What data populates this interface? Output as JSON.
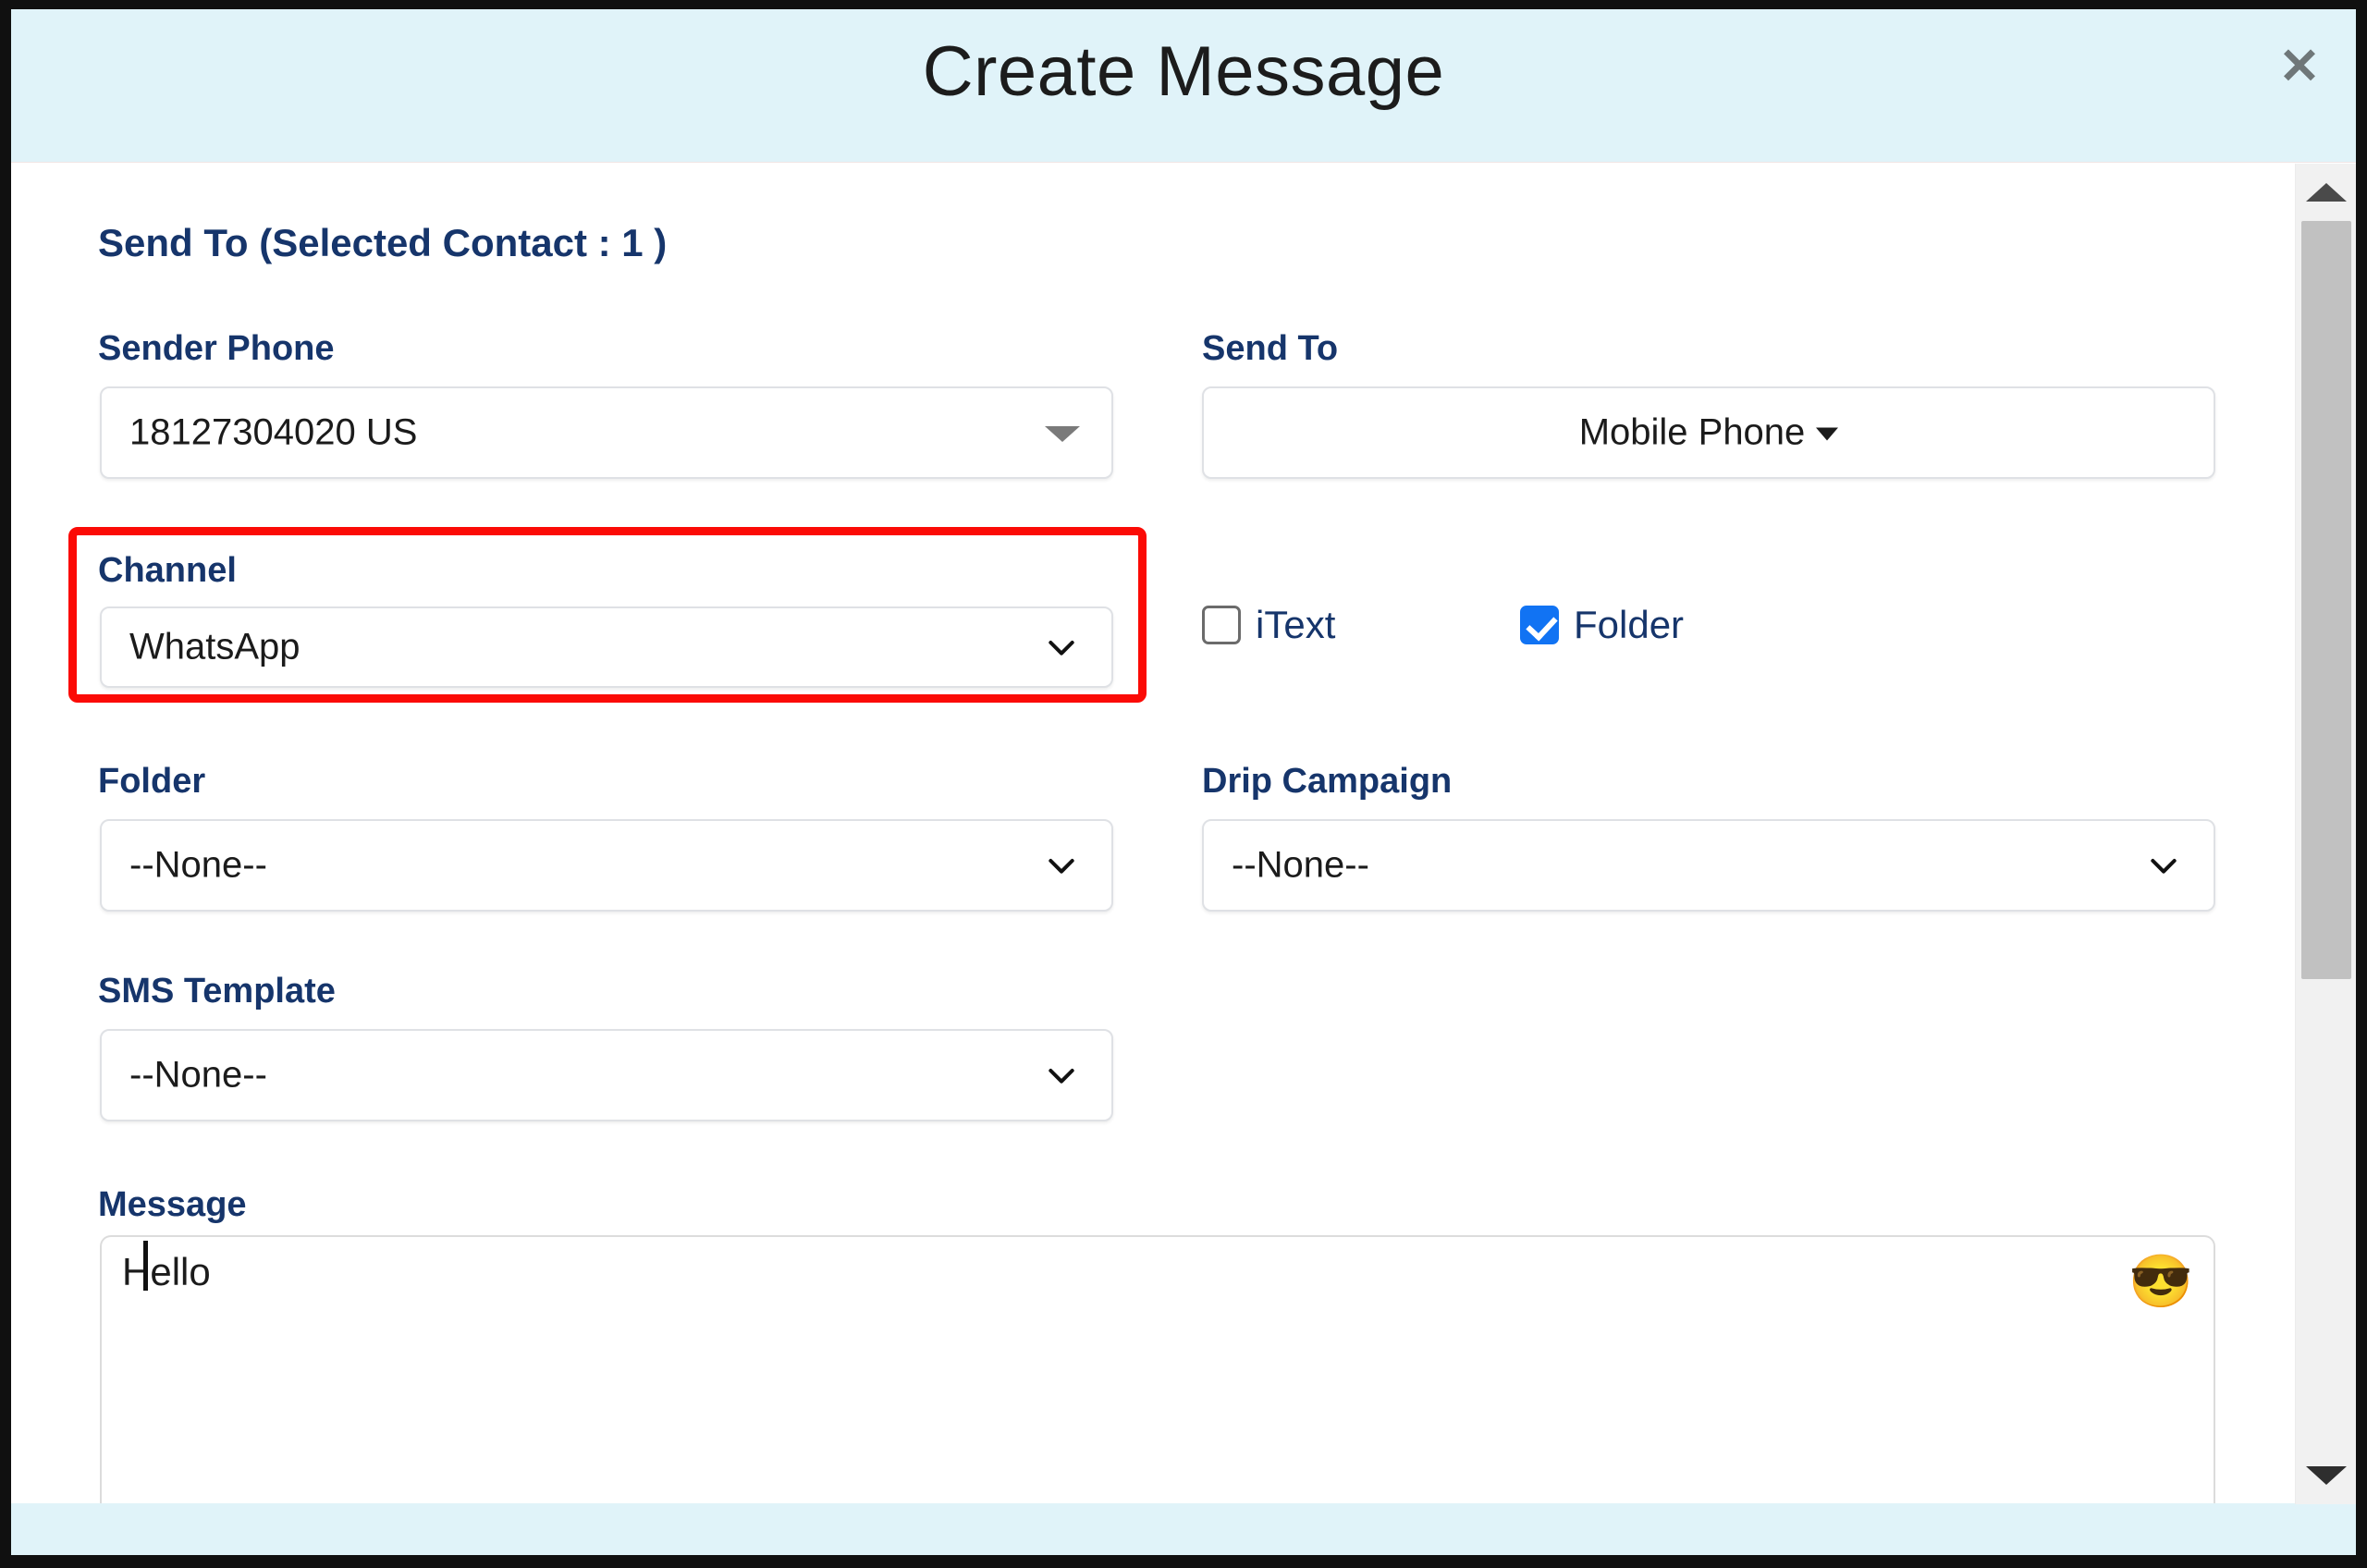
{
  "modal": {
    "title": "Create Message",
    "close_icon": "close-icon",
    "close_label": "✕",
    "header_bg": "#e0f3f9",
    "accent_highlight": "#fb0b06",
    "label_color": "#16356b",
    "checkbox_checked_color": "#1173f3"
  },
  "send_to_summary": "Send To (Selected Contact : 1 )",
  "fields": {
    "sender_phone": {
      "label": "Sender Phone",
      "value": "18127304020 US",
      "icon": "triangle-down-icon"
    },
    "send_to": {
      "label": "Send To",
      "value": "Mobile Phone",
      "icon": "caret-down-icon"
    },
    "channel": {
      "label": "Channel",
      "value": "WhatsApp",
      "icon": "chevron-down-icon",
      "highlighted": "true"
    },
    "folder": {
      "label": "Folder",
      "value": "--None--",
      "icon": "chevron-down-icon"
    },
    "drip_campaign": {
      "label": "Drip Campaign",
      "value": "--None--",
      "icon": "chevron-down-icon"
    },
    "sms_template": {
      "label": "SMS Template",
      "value": "--None--",
      "icon": "chevron-down-icon"
    },
    "message": {
      "label": "Message",
      "value": "Hello ",
      "placeholder": "",
      "emoji_icon": "sunglasses-smiley-icon",
      "emoji_glyph": "😎"
    }
  },
  "checkboxes": [
    {
      "label": "iText",
      "checked": false
    },
    {
      "label": "Folder",
      "checked": true
    }
  ],
  "scrollbar": {
    "up_icon": "scroll-up-arrow-icon",
    "down_icon": "scroll-down-arrow-icon",
    "thumb_name": "scrollbar-thumb"
  }
}
